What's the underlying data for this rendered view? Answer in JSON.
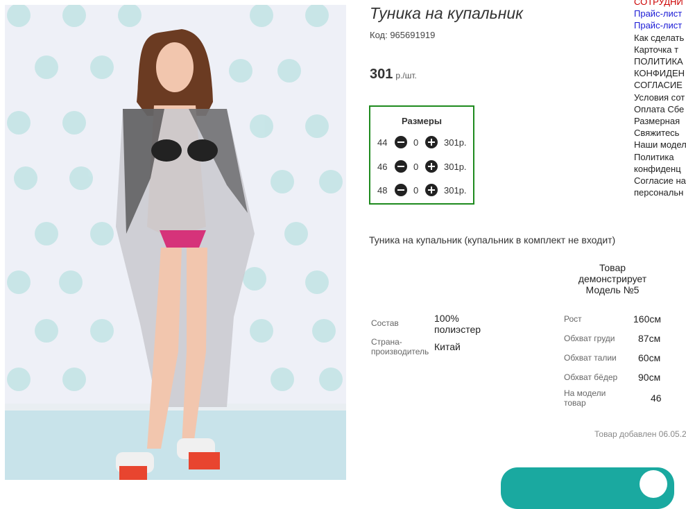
{
  "product": {
    "title": "Туника на купальник",
    "code": "Код: 965691919",
    "price_value": "301",
    "price_unit": "р./шт."
  },
  "sizes": {
    "title": "Размеры",
    "rows": [
      {
        "size": "44",
        "qty": "0",
        "price": "301р."
      },
      {
        "size": "46",
        "qty": "0",
        "price": "301р."
      },
      {
        "size": "48",
        "qty": "0",
        "price": "301р."
      }
    ]
  },
  "description": "Туника на купальник (купальник в комплект не входит)",
  "model_note": "Товар демонстрирует Модель №5",
  "specs": {
    "composition_label": "Состав",
    "composition_value": "100% полиэстер",
    "country_label": "Страна-производитель",
    "country_value": "Китай"
  },
  "model_params": {
    "height_label": "Рост",
    "height_value": "160см",
    "chest_label": "Обхват груди",
    "chest_value": "87см",
    "waist_label": "Обхват талии",
    "waist_value": "60см",
    "hips_label": "Обхват бёдер",
    "hips_value": "90см",
    "size_label": "На модели товар",
    "size_value": "46"
  },
  "added": "Товар добавлен 06.05.2",
  "sidebar": {
    "items": [
      "СОТРУДНИ",
      "Прайс-лист",
      "Прайс-лист",
      "Как сделать",
      "Карточка т",
      "ПОЛИТИКА",
      "КОНФИДЕН",
      "СОГЛАСИЕ",
      "Условия сот",
      "Оплата Сбе",
      "Размерная",
      "Свяжитесь",
      "Наши модел",
      "Политика",
      "конфиденц",
      "Согласие на",
      "персональн"
    ]
  },
  "colors": {
    "accent_green": "#1e8a1e",
    "link_blue": "#1a1ad6",
    "alert_red": "#cc0000",
    "button_teal": "#1aa9a0"
  }
}
